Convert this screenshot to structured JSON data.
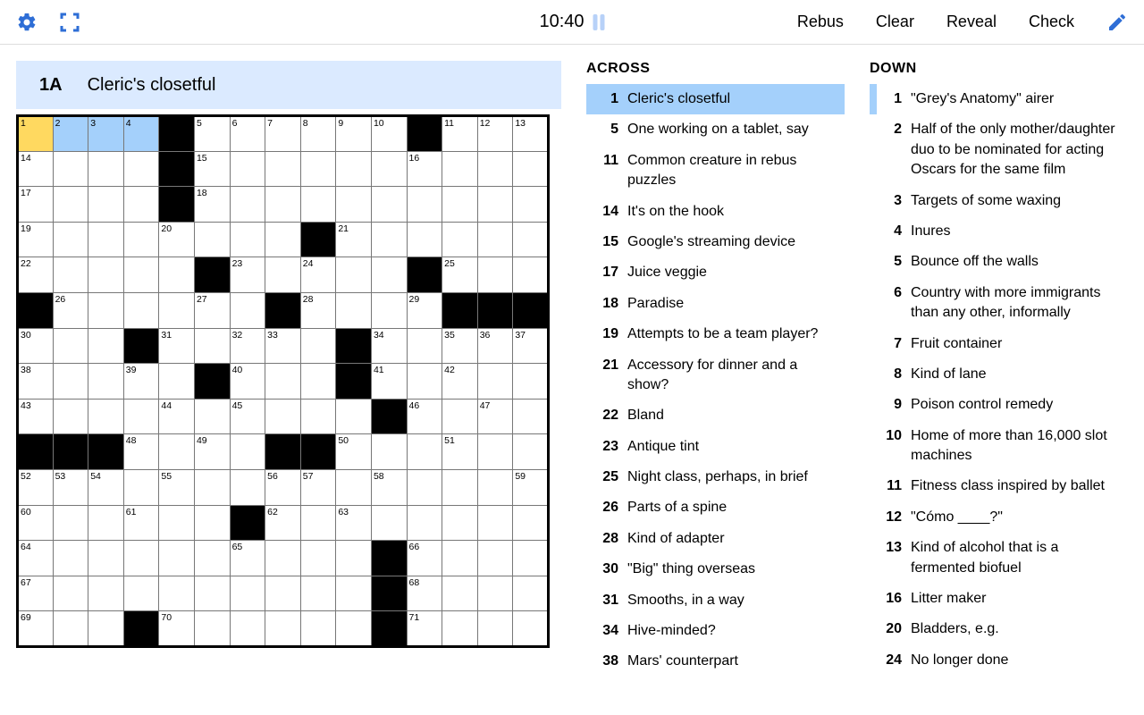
{
  "toolbar": {
    "timer": "10:40",
    "rebus": "Rebus",
    "clear": "Clear",
    "reveal": "Reveal",
    "check": "Check"
  },
  "current_clue": {
    "label": "1A",
    "text": "Cleric's closetful"
  },
  "grid": {
    "size": 15,
    "active_cell": [
      0,
      0
    ],
    "active_word_cells": [
      [
        0,
        1
      ],
      [
        0,
        2
      ],
      [
        0,
        3
      ]
    ],
    "rows": [
      [
        {
          "n": 1
        },
        {
          "n": 2
        },
        {
          "n": 3
        },
        {
          "n": 4
        },
        {
          "b": 1
        },
        {
          "n": 5
        },
        {
          "n": 6
        },
        {
          "n": 7
        },
        {
          "n": 8
        },
        {
          "n": 9
        },
        {
          "n": 10
        },
        {
          "b": 1
        },
        {
          "n": 11
        },
        {
          "n": 12
        },
        {
          "n": 13
        }
      ],
      [
        {
          "n": 14
        },
        {},
        {},
        {},
        {
          "b": 1
        },
        {
          "n": 15
        },
        {},
        {},
        {},
        {},
        {},
        {
          "n": 16
        },
        {},
        {},
        {}
      ],
      [
        {
          "n": 17
        },
        {},
        {},
        {},
        {
          "b": 1
        },
        {
          "n": 18
        },
        {},
        {},
        {},
        {},
        {},
        {},
        {},
        {},
        {}
      ],
      [
        {
          "n": 19
        },
        {},
        {},
        {},
        {
          "n": 20
        },
        {},
        {},
        {},
        {
          "b": 1
        },
        {
          "n": 21
        },
        {},
        {},
        {},
        {},
        {}
      ],
      [
        {
          "n": 22
        },
        {},
        {},
        {},
        {},
        {
          "b": 1
        },
        {
          "n": 23
        },
        {},
        {
          "n": 24
        },
        {},
        {},
        {
          "b": 1
        },
        {
          "n": 25
        },
        {},
        {}
      ],
      [
        {
          "b": 1
        },
        {
          "n": 26
        },
        {},
        {},
        {},
        {
          "n": 27
        },
        {},
        {
          "b": 1
        },
        {
          "n": 28
        },
        {},
        {},
        {
          "n": 29
        },
        {
          "b": 1
        },
        {
          "b": 1
        },
        {
          "b": 1
        }
      ],
      [
        {
          "n": 30
        },
        {},
        {},
        {
          "b": 1
        },
        {
          "n": 31
        },
        {},
        {
          "n": 32
        },
        {
          "n": 33
        },
        {},
        {
          "b": 1
        },
        {
          "n": 34
        },
        {},
        {
          "n": 35
        },
        {
          "n": 36
        },
        {
          "n": 37
        }
      ],
      [
        {
          "n": 38
        },
        {},
        {},
        {
          "n": 39
        },
        {},
        {
          "b": 1
        },
        {
          "n": 40
        },
        {},
        {},
        {
          "b": 1
        },
        {
          "n": 41
        },
        {},
        {
          "n": 42
        },
        {},
        {}
      ],
      [
        {
          "n": 43
        },
        {},
        {},
        {},
        {
          "n": 44
        },
        {},
        {
          "n": 45
        },
        {},
        {},
        {},
        {
          "b": 1
        },
        {
          "n": 46
        },
        {},
        {
          "n": 47
        },
        {}
      ],
      [
        {
          "b": 1
        },
        {
          "b": 1
        },
        {
          "b": 1
        },
        {
          "n": 48
        },
        {},
        {
          "n": 49
        },
        {},
        {
          "b": 1
        },
        {
          "b": 1
        },
        {
          "n": 50
        },
        {},
        {},
        {
          "n": 51
        },
        {},
        {}
      ],
      [
        {
          "n": 52
        },
        {
          "n": 53
        },
        {
          "n": 54
        },
        {},
        {
          "n": 55
        },
        {},
        {},
        {
          "n": 56
        },
        {
          "n": 57
        },
        {},
        {
          "n": 58
        },
        {},
        {},
        {},
        {
          "n": 59
        }
      ],
      [
        {
          "n": 60
        },
        {},
        {},
        {
          "n": 61
        },
        {},
        {},
        {
          "b": 1
        },
        {
          "n": 62
        },
        {},
        {
          "n": 63
        },
        {},
        {},
        {},
        {},
        {}
      ],
      [
        {
          "n": 64
        },
        {},
        {},
        {},
        {},
        {},
        {
          "n": 65
        },
        {},
        {},
        {},
        {
          "b": 1
        },
        {
          "n": 66
        },
        {},
        {},
        {}
      ],
      [
        {
          "n": 67
        },
        {},
        {},
        {},
        {},
        {},
        {},
        {},
        {},
        {},
        {
          "b": 1
        },
        {
          "n": 68
        },
        {},
        {},
        {}
      ],
      [
        {
          "n": 69
        },
        {},
        {},
        {
          "b": 1
        },
        {
          "n": 70
        },
        {},
        {},
        {},
        {},
        {},
        {
          "b": 1
        },
        {
          "n": 71
        },
        {},
        {},
        {}
      ]
    ]
  },
  "across_heading": "ACROSS",
  "down_heading": "DOWN",
  "across": [
    {
      "n": 1,
      "t": "Cleric's closetful",
      "active": true
    },
    {
      "n": 5,
      "t": "One working on a tablet, say"
    },
    {
      "n": 11,
      "t": "Common creature in rebus puzzles"
    },
    {
      "n": 14,
      "t": "It's on the hook"
    },
    {
      "n": 15,
      "t": "Google's streaming device"
    },
    {
      "n": 17,
      "t": "Juice veggie"
    },
    {
      "n": 18,
      "t": "Paradise"
    },
    {
      "n": 19,
      "t": "Attempts to be a team player?"
    },
    {
      "n": 21,
      "t": "Accessory for dinner and a show?"
    },
    {
      "n": 22,
      "t": "Bland"
    },
    {
      "n": 23,
      "t": "Antique tint"
    },
    {
      "n": 25,
      "t": "Night class, perhaps, in brief"
    },
    {
      "n": 26,
      "t": "Parts of a spine"
    },
    {
      "n": 28,
      "t": "Kind of adapter"
    },
    {
      "n": 30,
      "t": "\"Big\" thing overseas"
    },
    {
      "n": 31,
      "t": "Smooths, in a way"
    },
    {
      "n": 34,
      "t": "Hive-minded?"
    },
    {
      "n": 38,
      "t": "Mars' counterpart"
    }
  ],
  "down": [
    {
      "n": 1,
      "t": "\"Grey's Anatomy\" airer",
      "related": true
    },
    {
      "n": 2,
      "t": "Half of the only mother/daughter duo to be nominated for acting Oscars for the same film"
    },
    {
      "n": 3,
      "t": "Targets of some waxing"
    },
    {
      "n": 4,
      "t": "Inures"
    },
    {
      "n": 5,
      "t": "Bounce off the walls"
    },
    {
      "n": 6,
      "t": "Country with more immigrants than any other, informally"
    },
    {
      "n": 7,
      "t": "Fruit container"
    },
    {
      "n": 8,
      "t": "Kind of lane"
    },
    {
      "n": 9,
      "t": "Poison control remedy"
    },
    {
      "n": 10,
      "t": "Home of more than 16,000 slot machines"
    },
    {
      "n": 11,
      "t": "Fitness class inspired by ballet"
    },
    {
      "n": 12,
      "t": "\"Cómo ____?\""
    },
    {
      "n": 13,
      "t": "Kind of alcohol that is a fermented biofuel"
    },
    {
      "n": 16,
      "t": "Litter maker"
    },
    {
      "n": 20,
      "t": "Bladders, e.g."
    },
    {
      "n": 24,
      "t": "No longer done"
    }
  ]
}
